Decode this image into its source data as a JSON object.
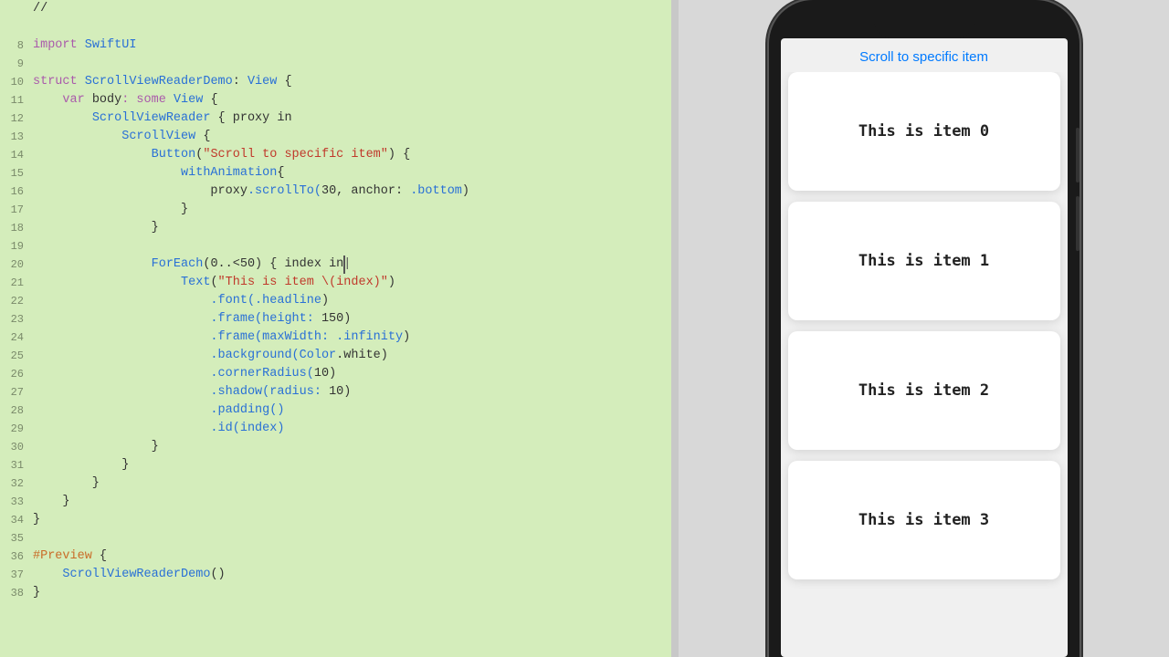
{
  "editor": {
    "background": "#d4edbb",
    "lines": [
      {
        "num": "",
        "content": "//",
        "raw": true
      },
      {
        "num": "",
        "content": "",
        "raw": true
      },
      {
        "num": "8",
        "tokens": [
          {
            "text": "import ",
            "class": "kw"
          },
          {
            "text": "SwiftUI",
            "class": "type"
          }
        ]
      },
      {
        "num": "9",
        "content": "",
        "raw": true
      },
      {
        "num": "10",
        "tokens": [
          {
            "text": "struct ",
            "class": "kw"
          },
          {
            "text": "ScrollViewReaderDemo",
            "class": "type"
          },
          {
            "text": ": ",
            "class": ""
          },
          {
            "text": "View",
            "class": "type"
          },
          {
            "text": " {",
            "class": ""
          }
        ]
      },
      {
        "num": "11",
        "tokens": [
          {
            "text": "    var ",
            "class": "kw"
          },
          {
            "text": "body",
            "class": ""
          },
          {
            "text": ": some ",
            "class": "kw"
          },
          {
            "text": "View",
            "class": "type"
          },
          {
            "text": " {",
            "class": ""
          }
        ]
      },
      {
        "num": "12",
        "tokens": [
          {
            "text": "        ",
            "class": ""
          },
          {
            "text": "ScrollViewReader",
            "class": "type"
          },
          {
            "text": " { proxy in",
            "class": ""
          }
        ]
      },
      {
        "num": "13",
        "tokens": [
          {
            "text": "            ",
            "class": ""
          },
          {
            "text": "ScrollView",
            "class": "type"
          },
          {
            "text": " {",
            "class": ""
          }
        ]
      },
      {
        "num": "14",
        "tokens": [
          {
            "text": "                ",
            "class": ""
          },
          {
            "text": "Button",
            "class": "type"
          },
          {
            "text": "(",
            "class": ""
          },
          {
            "text": "\"Scroll to specific item\"",
            "class": "str"
          },
          {
            "text": ") {",
            "class": ""
          }
        ]
      },
      {
        "num": "15",
        "tokens": [
          {
            "text": "                    withAnimation",
            "class": "fn"
          },
          {
            "text": "{",
            "class": ""
          }
        ]
      },
      {
        "num": "16",
        "tokens": [
          {
            "text": "                        proxy",
            "class": ""
          },
          {
            "text": ".scrollTo(",
            "class": "fn"
          },
          {
            "text": "30",
            "class": ""
          },
          {
            "text": ", anchor: ",
            "class": ""
          },
          {
            "text": ".bottom",
            "class": "kw-blue"
          },
          {
            "text": ")",
            "class": ""
          }
        ]
      },
      {
        "num": "17",
        "tokens": [
          {
            "text": "                    }",
            "class": ""
          }
        ]
      },
      {
        "num": "18",
        "tokens": [
          {
            "text": "                }",
            "class": ""
          }
        ]
      },
      {
        "num": "19",
        "content": "",
        "raw": true
      },
      {
        "num": "20",
        "tokens": [
          {
            "text": "                ",
            "class": ""
          },
          {
            "text": "ForEach",
            "class": "type"
          },
          {
            "text": "(0..<50) { index in",
            "class": ""
          },
          {
            "text": "█",
            "class": "cursor"
          }
        ]
      },
      {
        "num": "21",
        "tokens": [
          {
            "text": "                    ",
            "class": ""
          },
          {
            "text": "Text",
            "class": "type"
          },
          {
            "text": "(",
            "class": ""
          },
          {
            "text": "\"This is item \\(index)\"",
            "class": "str"
          },
          {
            "text": ")",
            "class": ""
          }
        ]
      },
      {
        "num": "22",
        "tokens": [
          {
            "text": "                        .font(",
            "class": "fn"
          },
          {
            "text": ".headline",
            "class": "kw-blue"
          },
          {
            "text": ")",
            "class": ""
          }
        ]
      },
      {
        "num": "23",
        "tokens": [
          {
            "text": "                        .frame(height: ",
            "class": "fn"
          },
          {
            "text": "150",
            "class": ""
          },
          {
            "text": ")",
            "class": ""
          }
        ]
      },
      {
        "num": "24",
        "tokens": [
          {
            "text": "                        .frame(maxWidth: ",
            "class": "fn"
          },
          {
            "text": ".infinity",
            "class": "kw-blue"
          },
          {
            "text": ")",
            "class": ""
          }
        ]
      },
      {
        "num": "25",
        "tokens": [
          {
            "text": "                        .background(",
            "class": "fn"
          },
          {
            "text": "Color",
            "class": "type"
          },
          {
            "text": ".white)",
            "class": ""
          }
        ]
      },
      {
        "num": "26",
        "tokens": [
          {
            "text": "                        .cornerRadius(",
            "class": "fn"
          },
          {
            "text": "10",
            "class": ""
          },
          {
            "text": ")",
            "class": ""
          }
        ]
      },
      {
        "num": "27",
        "tokens": [
          {
            "text": "                        .shadow(radius: ",
            "class": "fn"
          },
          {
            "text": "10",
            "class": ""
          },
          {
            "text": ")",
            "class": ""
          }
        ]
      },
      {
        "num": "28",
        "tokens": [
          {
            "text": "                        .padding()",
            "class": "fn"
          }
        ]
      },
      {
        "num": "29",
        "tokens": [
          {
            "text": "                        .id(index)",
            "class": "fn"
          }
        ]
      },
      {
        "num": "30",
        "tokens": [
          {
            "text": "                }",
            "class": ""
          }
        ]
      },
      {
        "num": "31",
        "tokens": [
          {
            "text": "            }",
            "class": ""
          }
        ]
      },
      {
        "num": "32",
        "tokens": [
          {
            "text": "        }",
            "class": ""
          }
        ]
      },
      {
        "num": "33",
        "tokens": [
          {
            "text": "    }",
            "class": ""
          }
        ]
      },
      {
        "num": "34",
        "tokens": [
          {
            "text": "}",
            "class": ""
          }
        ]
      },
      {
        "num": "35",
        "content": "",
        "raw": true
      },
      {
        "num": "36",
        "tokens": [
          {
            "text": "#Preview",
            "class": "kw-orange"
          },
          {
            "text": " {",
            "class": ""
          }
        ]
      },
      {
        "num": "37",
        "tokens": [
          {
            "text": "    ",
            "class": ""
          },
          {
            "text": "ScrollViewReaderDemo",
            "class": "fn"
          },
          {
            "text": "()",
            "class": ""
          }
        ]
      },
      {
        "num": "38",
        "tokens": [
          {
            "text": "}",
            "class": ""
          }
        ]
      }
    ]
  },
  "preview": {
    "scroll_button": "Scroll to specific item",
    "items": [
      {
        "id": 0,
        "label": "This is item 0"
      },
      {
        "id": 1,
        "label": "This is item 1"
      },
      {
        "id": 2,
        "label": "This is item 2"
      },
      {
        "id": 3,
        "label": "This is item 3"
      }
    ]
  }
}
